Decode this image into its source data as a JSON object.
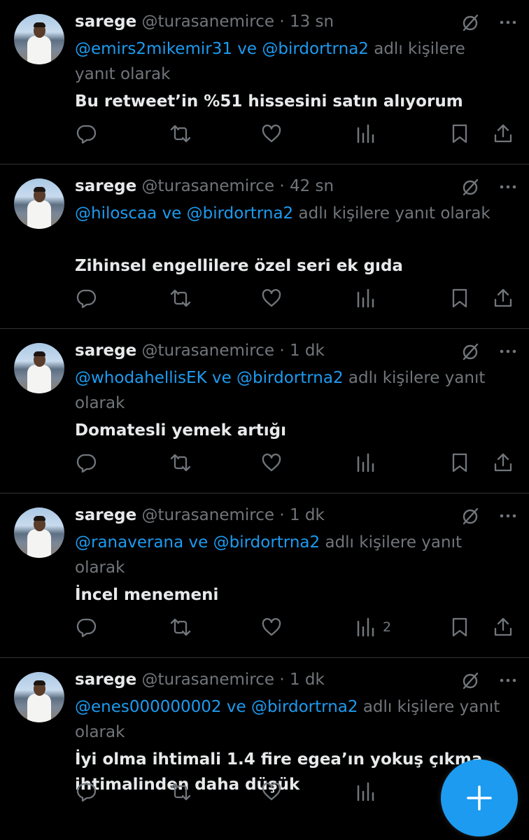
{
  "colors": {
    "background": "#000000",
    "text": "#e7e9ea",
    "muted": "#71767b",
    "accent": "#1d9bf0",
    "divider": "#2f3336"
  },
  "icons": {
    "grok": "grok-slash-circle-icon",
    "more": "more-dots-icon",
    "reply": "reply-icon",
    "retweet": "retweet-icon",
    "like": "heart-icon",
    "views": "views-bar-chart-icon",
    "bookmark": "bookmark-icon",
    "share": "share-upload-icon",
    "compose": "compose-plus-icon"
  },
  "tweets": [
    {
      "name": "sarege",
      "handle": "@turasanemirce",
      "dot": "·",
      "time": "13 sn",
      "reply_to": [
        "@emirs2mikemir31",
        "@birdortrna2"
      ],
      "connector": "ve",
      "reply_suffix": "adlı kişilere yanıt olarak",
      "text": "Bu retweet’in %51 hissesini satın alıyorum",
      "views": ""
    },
    {
      "name": "sarege",
      "handle": "@turasanemirce",
      "dot": "·",
      "time": "42 sn",
      "reply_to": [
        "@hiloscaa",
        "@birdortrna2"
      ],
      "connector": "ve",
      "reply_suffix": "adlı kişilere yanıt olarak",
      "text": "Zihinsel engellilere özel seri ek gıda",
      "views": ""
    },
    {
      "name": "sarege",
      "handle": "@turasanemirce",
      "dot": "·",
      "time": "1 dk",
      "reply_to": [
        "@whodahellisEK",
        "@birdortrna2"
      ],
      "connector": "ve",
      "reply_suffix": "adlı kişilere yanıt olarak",
      "text": "Domatesli yemek artığı",
      "views": ""
    },
    {
      "name": "sarege",
      "handle": "@turasanemirce",
      "dot": "·",
      "time": "1 dk",
      "reply_to": [
        "@ranaverana",
        "@birdortrna2"
      ],
      "connector": "ve",
      "reply_suffix": "adlı kişilere yanıt olarak",
      "text": "İncel menemeni",
      "views": "2"
    },
    {
      "name": "sarege",
      "handle": "@turasanemirce",
      "dot": "·",
      "time": "1 dk",
      "reply_to": [
        "@enes000000002",
        "@birdortrna2"
      ],
      "connector": "ve",
      "reply_suffix": "adlı kişilere yanıt olarak",
      "text": "İyi olma ihtimali 1.4 fire egea’ın yokuş çıkma ihtimalinden daha düşük",
      "views": ""
    }
  ]
}
